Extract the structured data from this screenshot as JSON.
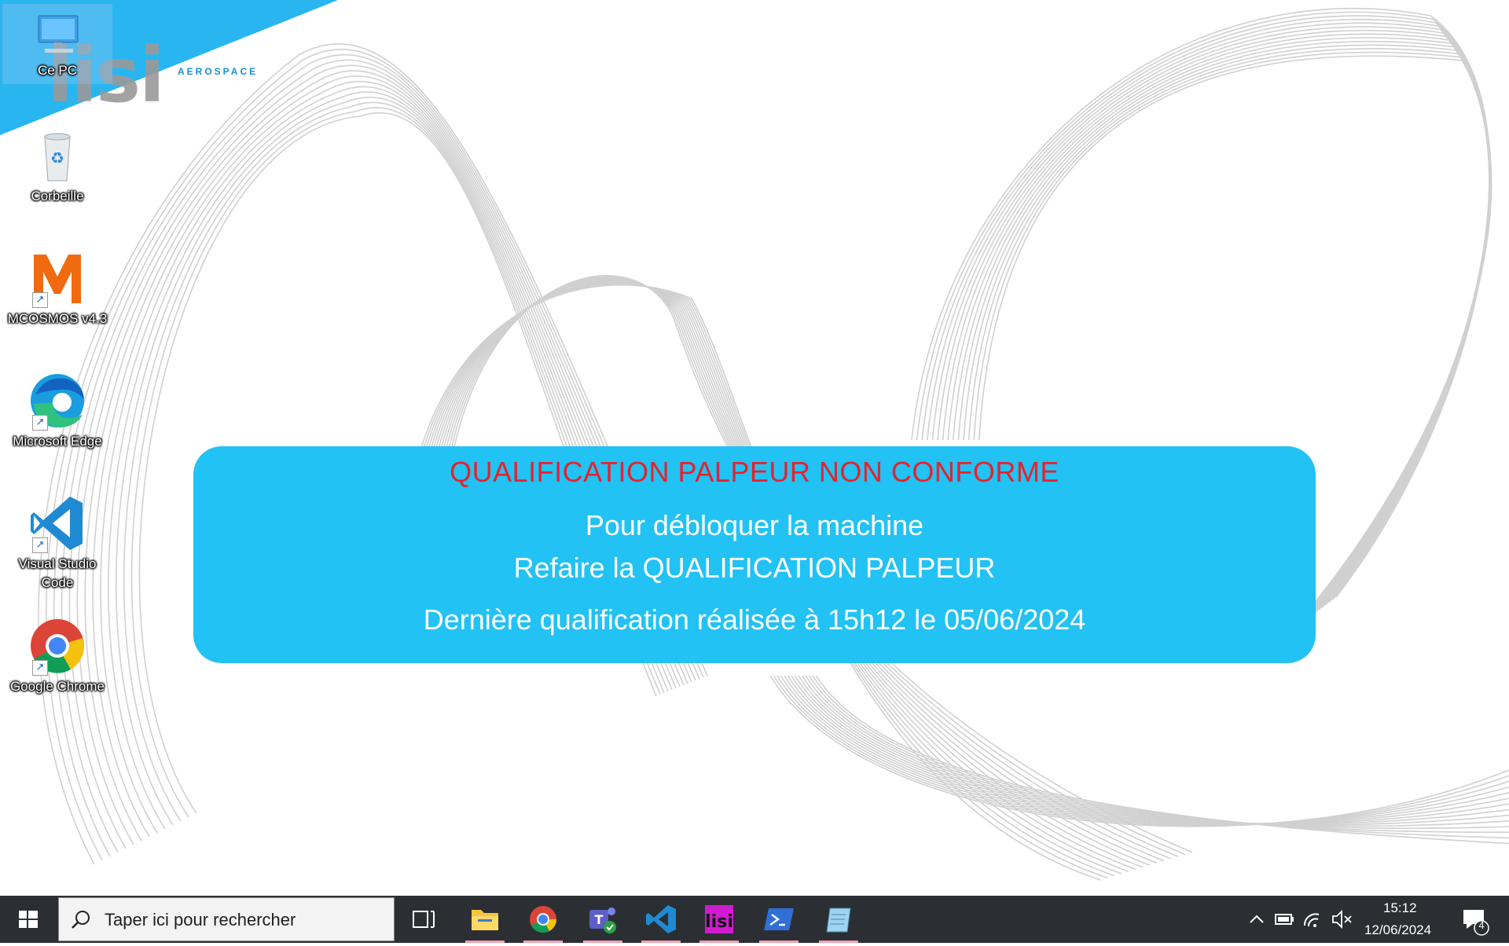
{
  "brand": {
    "logo_text": "lisi",
    "subtitle": "AEROSPACE",
    "accent_color": "#29b6f0"
  },
  "desktop_icons": [
    {
      "label": "Ce PC",
      "icon": "computer-icon"
    },
    {
      "label": "Corbeille",
      "icon": "recycle-bin-icon"
    },
    {
      "label": "MCOSMOS v4.3",
      "icon": "mcosmos-icon"
    },
    {
      "label": "Microsoft Edge",
      "icon": "edge-icon"
    },
    {
      "label": "Visual Studio Code",
      "icon": "vscode-icon"
    },
    {
      "label": "Google Chrome",
      "icon": "chrome-icon"
    }
  ],
  "banner": {
    "title": "QUALIFICATION PALPEUR NON CONFORME",
    "line1": "Pour débloquer la machine",
    "line2": "Refaire la QUALIFICATION PALPEUR",
    "line3": "Dernière qualification réalisée à 15h12 le 05/06/2024",
    "bg_color": "#22c2f4",
    "title_color": "#e4232c"
  },
  "taskbar": {
    "search_placeholder": "Taper ici pour rechercher",
    "apps": [
      "task-view-icon",
      "file-explorer-icon",
      "chrome-icon",
      "teams-icon",
      "vscode-icon",
      "lisi-app-icon",
      "powershell-icon",
      "notepad-icon"
    ],
    "time": "15:12",
    "date": "12/06/2024",
    "notification_count": "4"
  }
}
